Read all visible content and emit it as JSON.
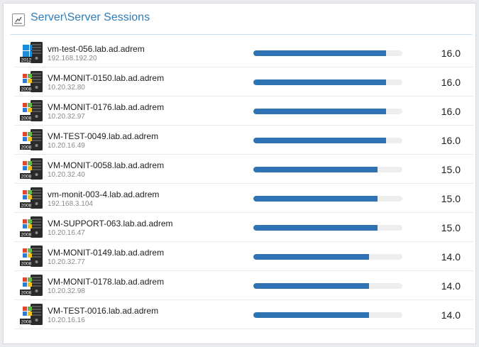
{
  "panel": {
    "title": "Server\\Server Sessions",
    "icon": "line-chart-icon"
  },
  "colors": {
    "accent": "#2e7cb8",
    "bar": "#2e73b4",
    "track": "#eeeeee"
  },
  "bar_max": 18,
  "sessions": [
    {
      "host": "vm-test-056.lab.ad.adrem",
      "ip": "192.168.192.20",
      "os_badge": "2012",
      "value": "16.0",
      "sessions": 16.0
    },
    {
      "host": "VM-MONIT-0150.lab.ad.adrem",
      "ip": "10.20.32.80",
      "os_badge": "2008",
      "value": "16.0",
      "sessions": 16.0
    },
    {
      "host": "VM-MONIT-0176.lab.ad.adrem",
      "ip": "10.20.32.97",
      "os_badge": "2008",
      "value": "16.0",
      "sessions": 16.0
    },
    {
      "host": "VM-TEST-0049.lab.ad.adrem",
      "ip": "10.20.16.49",
      "os_badge": "2008",
      "value": "16.0",
      "sessions": 16.0
    },
    {
      "host": "VM-MONIT-0058.lab.ad.adrem",
      "ip": "10.20.32.40",
      "os_badge": "2008",
      "value": "15.0",
      "sessions": 15.0
    },
    {
      "host": "vm-monit-003-4.lab.ad.adrem",
      "ip": "192.168.3.104",
      "os_badge": "2008",
      "value": "15.0",
      "sessions": 15.0
    },
    {
      "host": "VM-SUPPORT-063.lab.ad.adrem",
      "ip": "10.20.16.47",
      "os_badge": "2008",
      "value": "15.0",
      "sessions": 15.0
    },
    {
      "host": "VM-MONIT-0149.lab.ad.adrem",
      "ip": "10.20.32.77",
      "os_badge": "2008",
      "value": "14.0",
      "sessions": 14.0
    },
    {
      "host": "VM-MONIT-0178.lab.ad.adrem",
      "ip": "10.20.32.98",
      "os_badge": "2008",
      "value": "14.0",
      "sessions": 14.0
    },
    {
      "host": "VM-TEST-0016.lab.ad.adrem",
      "ip": "10.20.16.16",
      "os_badge": "2008",
      "value": "14.0",
      "sessions": 14.0
    }
  ]
}
